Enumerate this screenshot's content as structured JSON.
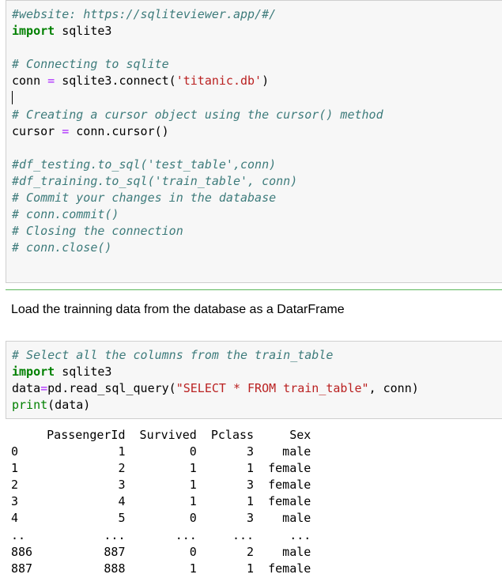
{
  "cell1": {
    "line1": "#website: https://sqliteviewer.app/#/",
    "line2_kw": "import",
    "line2_rest": " sqlite3",
    "line4": "# Connecting to sqlite",
    "line5_a": "conn ",
    "line5_op": "=",
    "line5_b": " sqlite3.connect(",
    "line5_str": "'titanic.db'",
    "line5_c": ")",
    "line7": "# Creating a cursor object using the cursor() method",
    "line8_a": "cursor ",
    "line8_op": "=",
    "line8_b": " conn.cursor()",
    "line10": "#df_testing.to_sql('test_table',conn)",
    "line11": "#df_training.to_sql('train_table', conn)",
    "line12": "# Commit your changes in the database",
    "line13": "# conn.commit()",
    "line14": "# Closing the connection",
    "line15": "# conn.close()"
  },
  "markdown": {
    "text": "Load the trainning data from the database as a DatarFrame"
  },
  "cell2": {
    "line1": "# Select all the columns from the train_table",
    "line2_kw": "import",
    "line2_rest": " sqlite3",
    "line3_a": "data",
    "line3_op": "=",
    "line3_b": "pd.read_sql_query(",
    "line3_str": "\"SELECT * FROM train_table\"",
    "line3_c": ", conn)",
    "line4_fn": "print",
    "line4_rest": "(data)"
  },
  "output": {
    "header": "     PassengerId  Survived  Pclass     Sex",
    "rows": [
      "0              1         0       3    male",
      "1              2         1       1  female",
      "2              3         1       3  female",
      "3              4         1       1  female",
      "4              5         0       3    male",
      "..           ...       ...     ...     ...",
      "886          887         0       2    male",
      "887          888         1       1  female"
    ]
  }
}
